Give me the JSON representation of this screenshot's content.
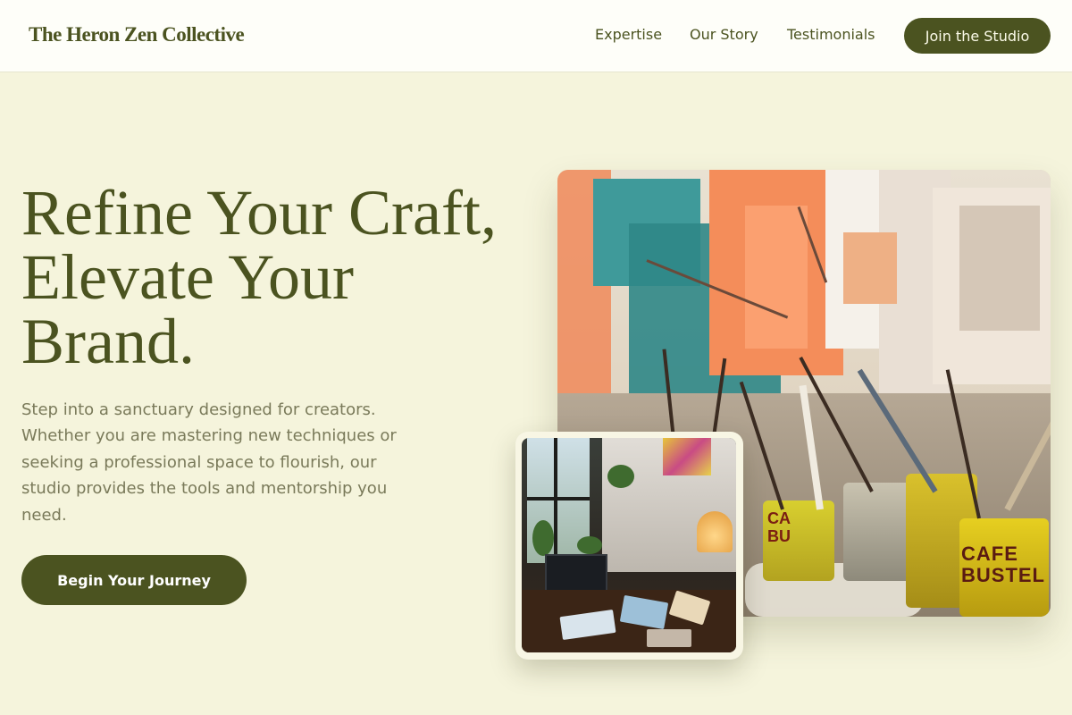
{
  "header": {
    "logo": "The Heron Zen Collective",
    "nav": [
      "Expertise",
      "Our Story",
      "Testimonials"
    ],
    "cta_label": "Join the Studio"
  },
  "hero": {
    "headline": "Refine Your Craft, Elevate Your Brand.",
    "lead": "Step into a sanctuary designed for creators. Whether you are mastering new techniques or seeking a professional space to flourish, our studio provides the tools and mentorship you need.",
    "cta_label": "Begin Your Journey"
  },
  "images": {
    "main_can_label": "CAFE\nBUSTEL",
    "small_can_label": "CA\nBU"
  },
  "colors": {
    "background": "#f5f4dc",
    "header_bg": "#fefef9",
    "accent": "#4b5320",
    "muted_text": "#7a7a5a"
  }
}
